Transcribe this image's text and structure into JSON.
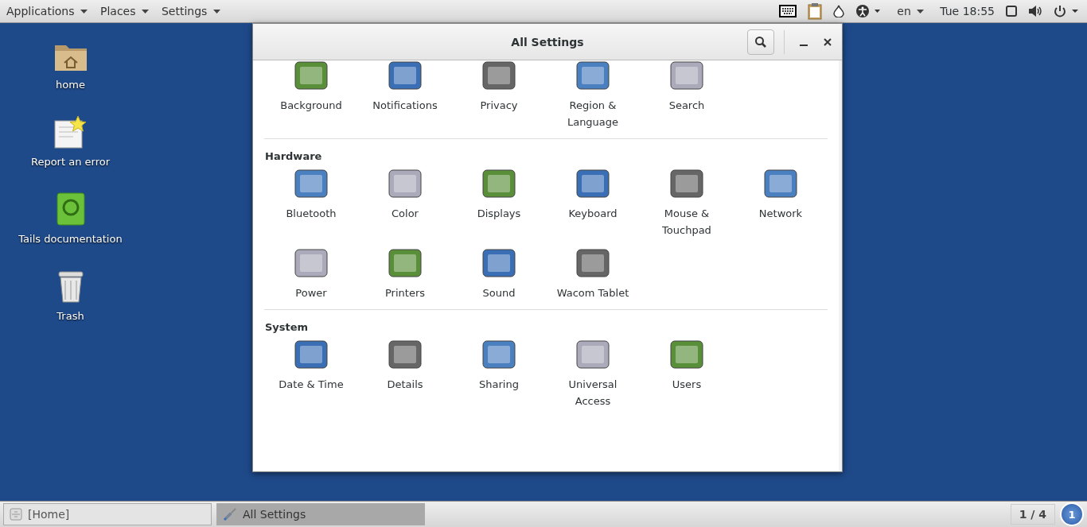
{
  "top_bar": {
    "menus": [
      {
        "label": "Applications"
      },
      {
        "label": "Places"
      },
      {
        "label": "Settings"
      }
    ],
    "language": "en",
    "clock": "Tue 18:55"
  },
  "desktop_icons": [
    {
      "label": "home",
      "kind": "folder"
    },
    {
      "label": "Report an error",
      "kind": "report"
    },
    {
      "label": "Tails documentation",
      "kind": "book"
    },
    {
      "label": "Trash",
      "kind": "trash"
    }
  ],
  "window": {
    "title": "All Settings",
    "sections": [
      {
        "items": [
          {
            "label": "Background"
          },
          {
            "label": "Notifications"
          },
          {
            "label": "Privacy"
          },
          {
            "label": "Region & Language"
          },
          {
            "label": "Search"
          }
        ]
      },
      {
        "title": "Hardware",
        "items": [
          {
            "label": "Bluetooth"
          },
          {
            "label": "Color"
          },
          {
            "label": "Displays"
          },
          {
            "label": "Keyboard"
          },
          {
            "label": "Mouse & Touchpad"
          },
          {
            "label": "Network"
          },
          {
            "label": "Power"
          },
          {
            "label": "Printers"
          },
          {
            "label": "Sound"
          },
          {
            "label": "Wacom Tablet"
          }
        ]
      },
      {
        "title": "System",
        "items": [
          {
            "label": "Date & Time"
          },
          {
            "label": "Details"
          },
          {
            "label": "Sharing"
          },
          {
            "label": "Universal Access"
          },
          {
            "label": "Users"
          }
        ]
      }
    ]
  },
  "taskbar": {
    "tasks": [
      {
        "label": "[Home]",
        "selected": false
      },
      {
        "label": "All Settings",
        "selected": true
      }
    ],
    "workspace": "1 / 4",
    "notifications": "1"
  }
}
